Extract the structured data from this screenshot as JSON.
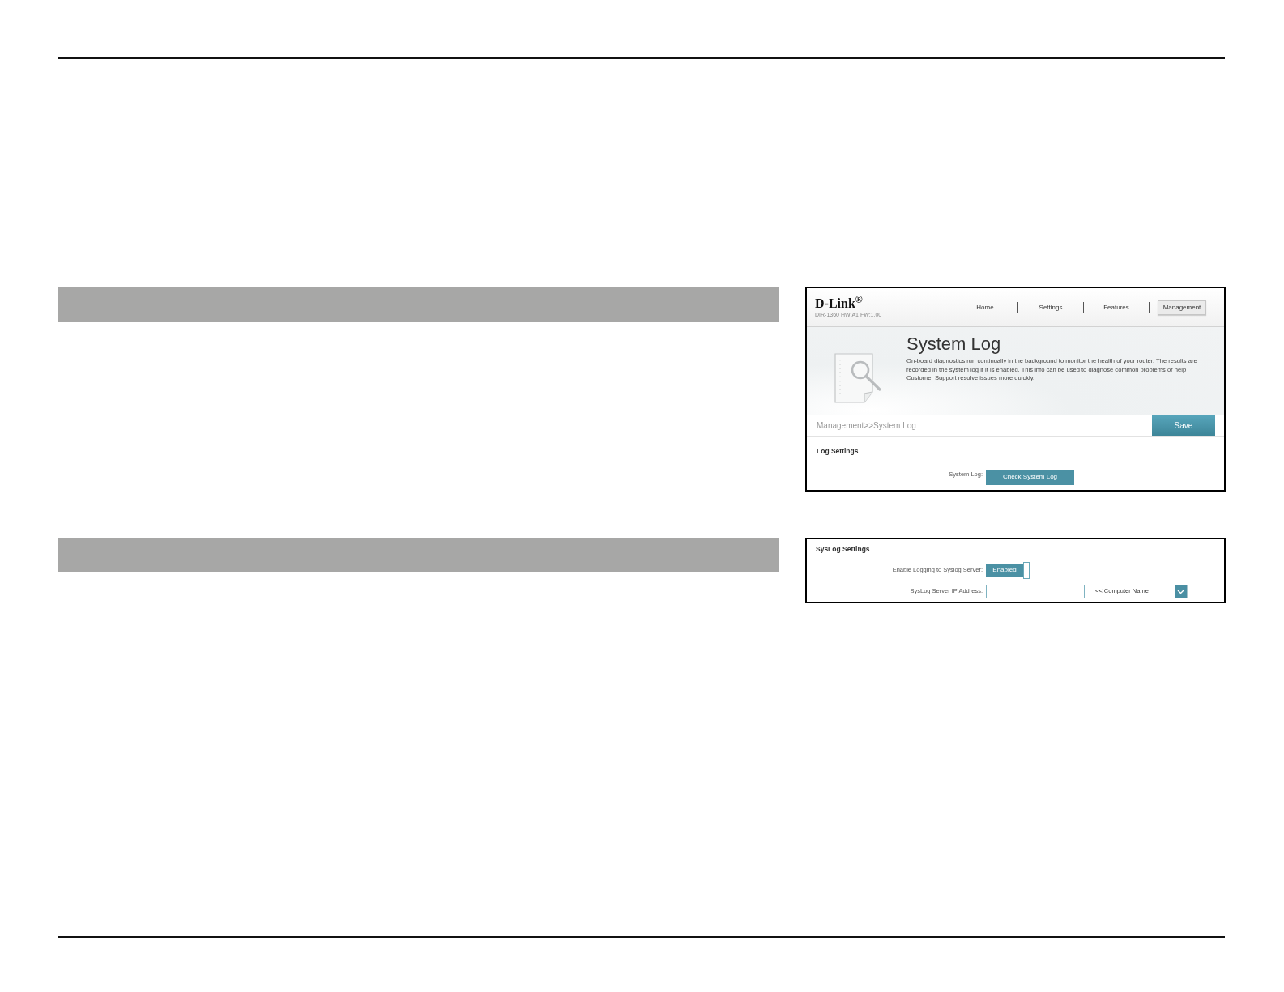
{
  "system_log_screen": {
    "logo": "D-Link$^{®}$",
    "model": "DIR-1360 HW:A1 FW:1.00",
    "nav": [
      {
        "label": "Home",
        "selected": false
      },
      {
        "label": "Settings",
        "selected": false
      },
      {
        "label": "Features",
        "selected": false
      },
      {
        "label": "Management",
        "selected": true
      }
    ],
    "title": "System Log",
    "description": "On-board diagnostics run continually in the background to monitor the health of your router. The results are recorded in the system log if it is enabled. This info can be used to diagnose common problems or help Customer Support resolve issues more quickly.",
    "breadcrumb": "Management>>System Log",
    "save_button": "Save",
    "section_title": "Log Settings",
    "fields": [
      {
        "kind": "button",
        "label": "System Log:",
        "button": "Check System Log"
      }
    ]
  },
  "syslog_screen": {
    "section_title": "SysLog Settings",
    "fields": [
      {
        "kind": "toggle",
        "label": "Enable Logging to Syslog Server:",
        "value": "Enabled",
        "on": true
      },
      {
        "kind": "address",
        "label": "SysLog Server IP Address:",
        "select": "<< Computer Name"
      }
    ]
  }
}
